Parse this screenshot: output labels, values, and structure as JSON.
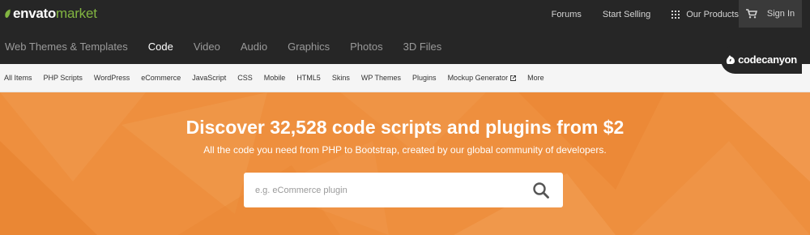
{
  "brand": {
    "main": "envato",
    "sub": "market"
  },
  "topnav": {
    "forums": "Forums",
    "start_selling": "Start Selling",
    "our_products": "Our Products",
    "sign_in": "Sign In"
  },
  "categories": [
    "Web Themes & Templates",
    "Code",
    "Video",
    "Audio",
    "Graphics",
    "Photos",
    "3D Files"
  ],
  "active_category": "Code",
  "badge": {
    "name": "codecanyon"
  },
  "subnav": [
    "All Items",
    "PHP Scripts",
    "WordPress",
    "eCommerce",
    "JavaScript",
    "CSS",
    "Mobile",
    "HTML5",
    "Skins",
    "WP Themes",
    "Plugins",
    "Mockup Generator",
    "More"
  ],
  "hero": {
    "title": "Discover 32,528 code scripts and plugins from $2",
    "subtitle": "All the code you need from PHP to Bootstrap, created by our global community of developers.",
    "search_placeholder": "e.g. eCommerce plugin"
  },
  "colors": {
    "topbar": "#262626",
    "brand_green": "#82b541",
    "hero_orange": "#ee8f3e",
    "subnav_bg": "#f5f5f5"
  },
  "icons": [
    "leaf-icon",
    "grid-icon",
    "cart-icon",
    "codecanyon-icon",
    "external-link-icon",
    "search-icon"
  ]
}
